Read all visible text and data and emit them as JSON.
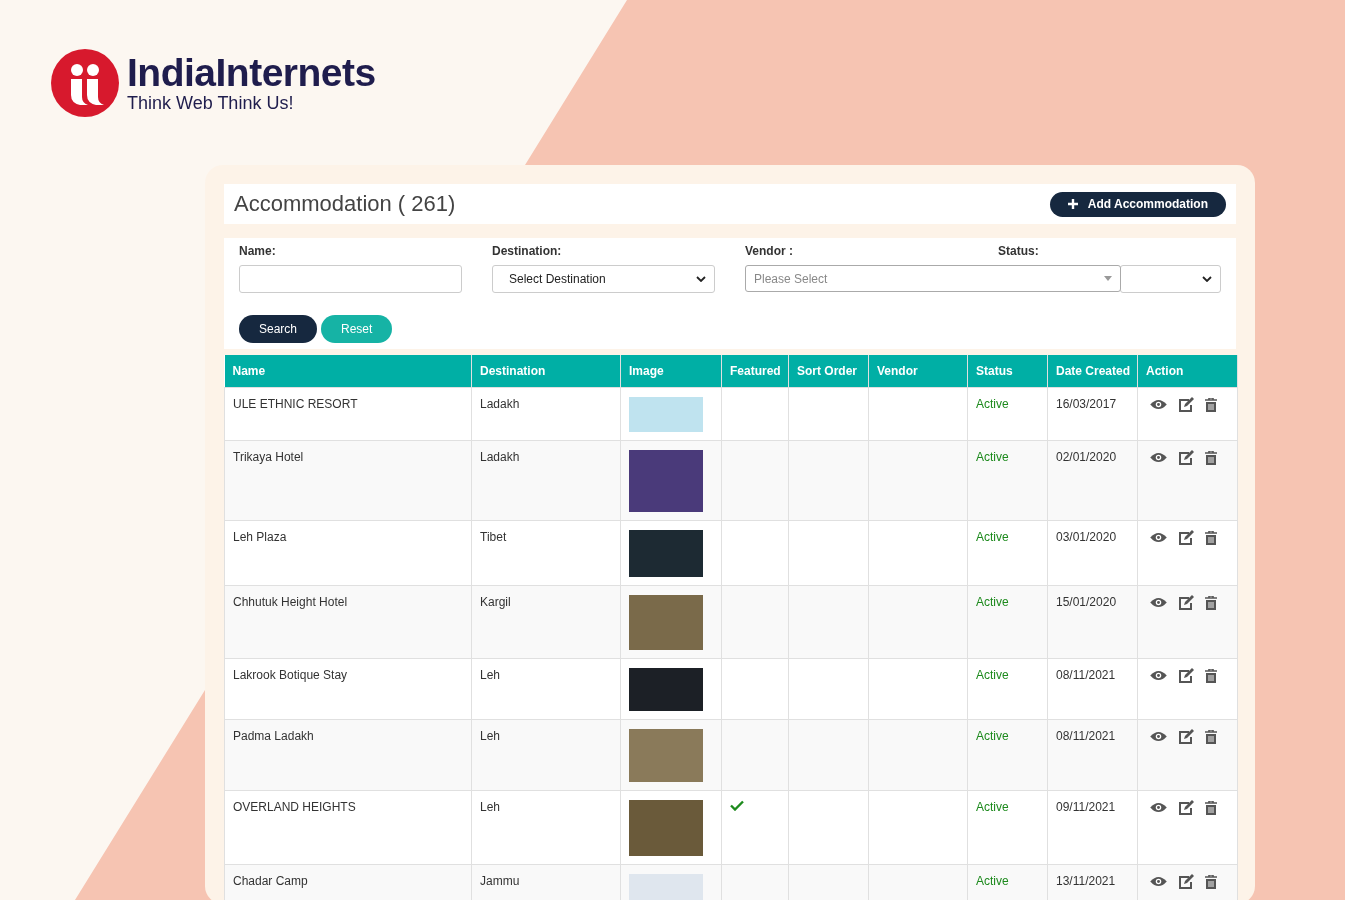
{
  "brand": {
    "name": "IndiaInternets",
    "tagline": "Think Web Think Us!"
  },
  "header": {
    "title": "Accommodation ( 261)",
    "add_button": "Add Accommodation"
  },
  "filters": [
    {
      "label": "Name:",
      "kind": "input"
    },
    {
      "label": "Destination:",
      "kind": "select",
      "value": "Select Destination"
    },
    {
      "label": "Vendor :",
      "kind": "combo",
      "placeholder": "Please Select"
    },
    {
      "label": "Status:",
      "kind": "select"
    }
  ],
  "buttons": {
    "search": "Search",
    "reset": "Reset"
  },
  "table": {
    "columns": [
      "Name",
      "Destination",
      "Image",
      "Featured",
      "Sort Order",
      "Vendor",
      "Status",
      "Date Created",
      "Action"
    ],
    "rows": [
      {
        "name": "ULE ETHNIC RESORT",
        "destination": "Ladakh",
        "featured": false,
        "status": "Active",
        "date": "16/03/2017"
      },
      {
        "name": "Trikaya Hotel",
        "destination": "Ladakh",
        "featured": false,
        "status": "Active",
        "date": "02/01/2020"
      },
      {
        "name": "Leh Plaza",
        "destination": "Tibet",
        "featured": false,
        "status": "Active",
        "date": "03/01/2020"
      },
      {
        "name": "Chhutuk Height Hotel",
        "destination": "Kargil",
        "featured": false,
        "status": "Active",
        "date": "15/01/2020"
      },
      {
        "name": "Lakrook Botique Stay",
        "destination": "Leh",
        "featured": false,
        "status": "Active",
        "date": "08/11/2021"
      },
      {
        "name": "Padma Ladakh",
        "destination": "Leh",
        "featured": false,
        "status": "Active",
        "date": "08/11/2021"
      },
      {
        "name": "OVERLAND HEIGHTS",
        "destination": "Leh",
        "featured": true,
        "status": "Active",
        "date": "09/11/2021"
      },
      {
        "name": "Chadar Camp",
        "destination": "Jammu",
        "featured": false,
        "status": "Active",
        "date": "13/11/2021"
      }
    ]
  }
}
